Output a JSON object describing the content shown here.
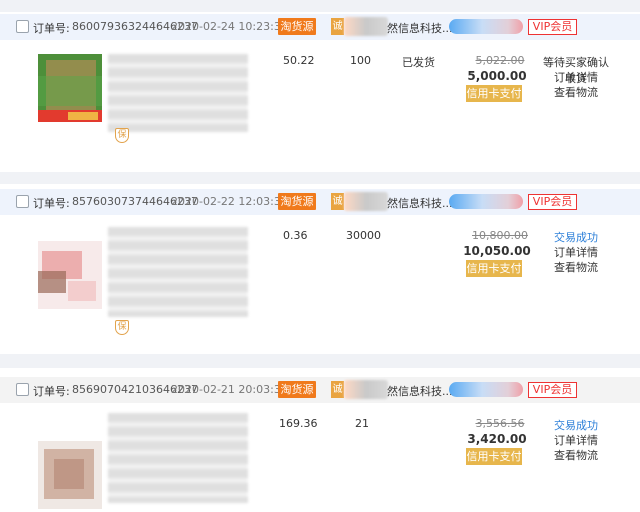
{
  "orders": [
    {
      "order_label": "订单号:",
      "order_id": "860079363244646237",
      "time": "2020-02-24 10:23:32",
      "source_tag": "淘货源",
      "cheng_badge": "诚",
      "store_name": "然信息科技...",
      "vip_label": "VIP会员",
      "unit_price": "50.22",
      "quantity": "100",
      "shipping_status": "已发货",
      "original_total": "5,022.00",
      "total": "5,000.00",
      "pay_label": "信用卡支付",
      "status": "等待买家确认收货",
      "detail_link": "订单详情",
      "logistics_link": "查看物流"
    },
    {
      "order_label": "订单号:",
      "order_id": "857603073744646237",
      "time": "2020-02-22 12:03:35",
      "source_tag": "淘货源",
      "cheng_badge": "诚",
      "store_name": "然信息科技...",
      "vip_label": "VIP会员",
      "unit_price": "0.36",
      "quantity": "30000",
      "shipping_status": "",
      "original_total": "10,800.00",
      "total": "10,050.00",
      "pay_label": "信用卡支付",
      "status": "交易成功",
      "detail_link": "订单详情",
      "logistics_link": "查看物流"
    },
    {
      "order_label": "订单号:",
      "order_id": "856907042103646237",
      "time": "2020-02-21 20:03:38",
      "source_tag": "淘货源",
      "cheng_badge": "诚",
      "store_name": "然信息科技...",
      "vip_label": "VIP会员",
      "unit_price": "169.36",
      "quantity": "21",
      "shipping_status": "",
      "original_total": "3,556.56",
      "total": "3,420.00",
      "pay_label": "信用卡支付",
      "status": "交易成功",
      "detail_link": "订单详情",
      "logistics_link": "查看物流"
    }
  ],
  "shield_glyph": "保",
  "colors": {
    "header_bg": "#eef3fc",
    "source_tag": "#f07a1c",
    "vip_red": "#e33333",
    "pay_button": "#e7b64c",
    "success_blue": "#2c7fd8"
  }
}
